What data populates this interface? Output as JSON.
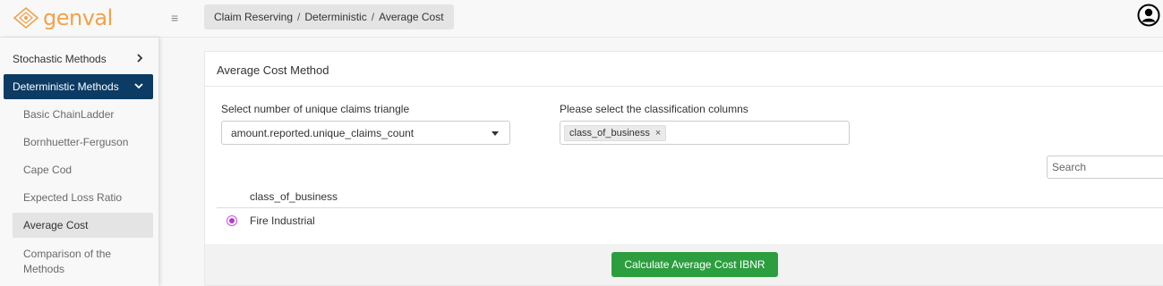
{
  "app": {
    "logo_text": "genval"
  },
  "header": {
    "menu_icon": "hamburger-icon",
    "breadcrumb": [
      "Claim Reserving",
      "Deterministic",
      "Average Cost"
    ],
    "breadcrumb_separator": "/",
    "user_icon": "user-avatar-icon"
  },
  "sidebar": {
    "sections": [
      {
        "label": "Stochastic Methods",
        "icon": "chevron-right-icon"
      },
      {
        "label": "Deterministic Methods",
        "icon": "chevron-down-icon",
        "active": true
      }
    ],
    "items": [
      {
        "label": "Basic ChainLadder"
      },
      {
        "label": "Bornhuetter-Ferguson"
      },
      {
        "label": "Cape Cod"
      },
      {
        "label": "Expected Loss Ratio"
      },
      {
        "label": "Average Cost",
        "selected": true
      },
      {
        "label": "Comparison of the Methods"
      }
    ],
    "active_color": "#0c3b63"
  },
  "main": {
    "title": "Average Cost Method",
    "triangle_select": {
      "label": "Select number of unique claims triangle",
      "value": "amount.reported.unique_claims_count"
    },
    "classification": {
      "label": "Please select the classification columns",
      "tags": [
        "class_of_business"
      ],
      "remove_symbol": "×"
    },
    "search": {
      "placeholder": "Search"
    },
    "table": {
      "columns": [
        "class_of_business"
      ],
      "rows": [
        {
          "selected": true,
          "values": [
            "Fire Industrial"
          ]
        }
      ]
    },
    "calculate_button": {
      "label": "Calculate Average Cost IBNR",
      "color": "#2c9e3f"
    }
  }
}
